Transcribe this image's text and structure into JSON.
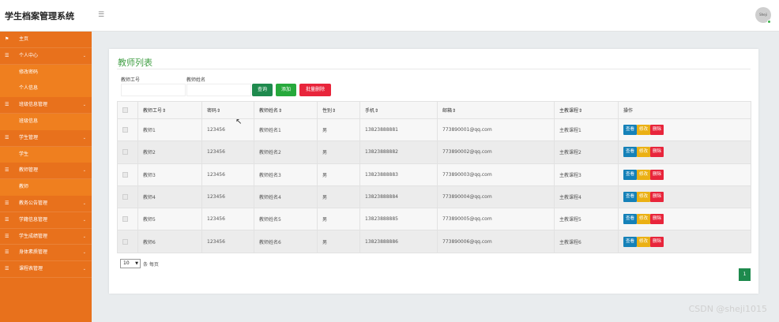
{
  "header": {
    "brand": "学生档案管理系统",
    "menu_icon": "hamburger-icon",
    "avatar_text": "Sheji"
  },
  "sidebar": {
    "items": [
      {
        "label": "主页",
        "icon": "flag-icon",
        "sub": []
      },
      {
        "label": "个人中心",
        "icon": "menu-icon",
        "sub": [
          "修改密码",
          "个人信息"
        ]
      },
      {
        "label": "班级信息管理",
        "icon": "menu-icon",
        "sub": [
          "班级信息"
        ]
      },
      {
        "label": "学生管理",
        "icon": "menu-icon",
        "sub": [
          "学生"
        ]
      },
      {
        "label": "教师管理",
        "icon": "menu-icon",
        "sub": [
          "教师"
        ]
      },
      {
        "label": "教务公告管理",
        "icon": "menu-icon",
        "sub": []
      },
      {
        "label": "学籍信息管理",
        "icon": "menu-icon",
        "sub": []
      },
      {
        "label": "学生成绩管理",
        "icon": "menu-icon",
        "sub": []
      },
      {
        "label": "身体素质管理",
        "icon": "menu-icon",
        "sub": []
      },
      {
        "label": "课程表管理",
        "icon": "menu-icon",
        "sub": []
      }
    ]
  },
  "panel": {
    "title": "教师列表",
    "search": {
      "label_no": "教师工号",
      "label_name": "教师姓名",
      "btn_search": "查询",
      "btn_add": "添加",
      "btn_batch_delete": "批量删除"
    },
    "table": {
      "headers": [
        "教师工号",
        "密码",
        "教师姓名",
        "性别",
        "手机",
        "邮箱",
        "主教课程",
        "操作"
      ],
      "rows": [
        [
          "教师1",
          "123456",
          "教师姓名1",
          "男",
          "13823888881",
          "773890001@qq.com",
          "主教课程1"
        ],
        [
          "教师2",
          "123456",
          "教师姓名2",
          "男",
          "13823888882",
          "773890002@qq.com",
          "主教课程2"
        ],
        [
          "教师3",
          "123456",
          "教师姓名3",
          "男",
          "13823888883",
          "773890003@qq.com",
          "主教课程3"
        ],
        [
          "教师4",
          "123456",
          "教师姓名4",
          "男",
          "13823888884",
          "773890004@qq.com",
          "主教课程4"
        ],
        [
          "教师5",
          "123456",
          "教师姓名5",
          "男",
          "13823888885",
          "773890005@qq.com",
          "主教课程5"
        ],
        [
          "教师6",
          "123456",
          "教师姓名6",
          "男",
          "13823888886",
          "773890006@qq.com",
          "主教课程6"
        ]
      ],
      "actions": {
        "view": "查看",
        "edit": "修改",
        "delete": "删除"
      }
    },
    "pagination": {
      "page_size": "10",
      "per_page_label": "条 每页",
      "current_page": "1"
    }
  },
  "watermark": "CSDN @sheji1015",
  "colors": {
    "sidebar": "#e8711c",
    "primary": "#1e8a4d",
    "add": "#27a93c",
    "danger": "#e8253b",
    "view": "#1581b8",
    "edit": "#ebb014",
    "title": "#43a047"
  }
}
